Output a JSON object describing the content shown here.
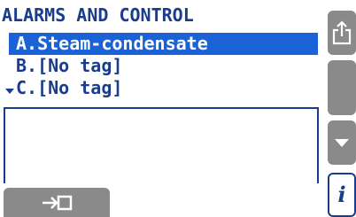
{
  "header": {
    "title": "ALARMS AND CONTROL"
  },
  "list": {
    "items": [
      {
        "label": "A.Steam-condensate",
        "selected": true
      },
      {
        "label": "B.[No tag]",
        "selected": false
      },
      {
        "label": "C.[No tag]",
        "selected": false
      }
    ]
  },
  "side_buttons": {
    "top": {
      "icon": "export-icon"
    },
    "middle": {
      "icon": "blank"
    },
    "down": {
      "icon": "down-arrow-icon"
    },
    "info": {
      "icon": "info-icon",
      "label": "i"
    }
  },
  "bottom_button": {
    "icon": "enter-icon"
  },
  "colors": {
    "accent": "#1a3c8c",
    "selection": "#1a62d6",
    "button_grey": "#8a8a8a"
  }
}
